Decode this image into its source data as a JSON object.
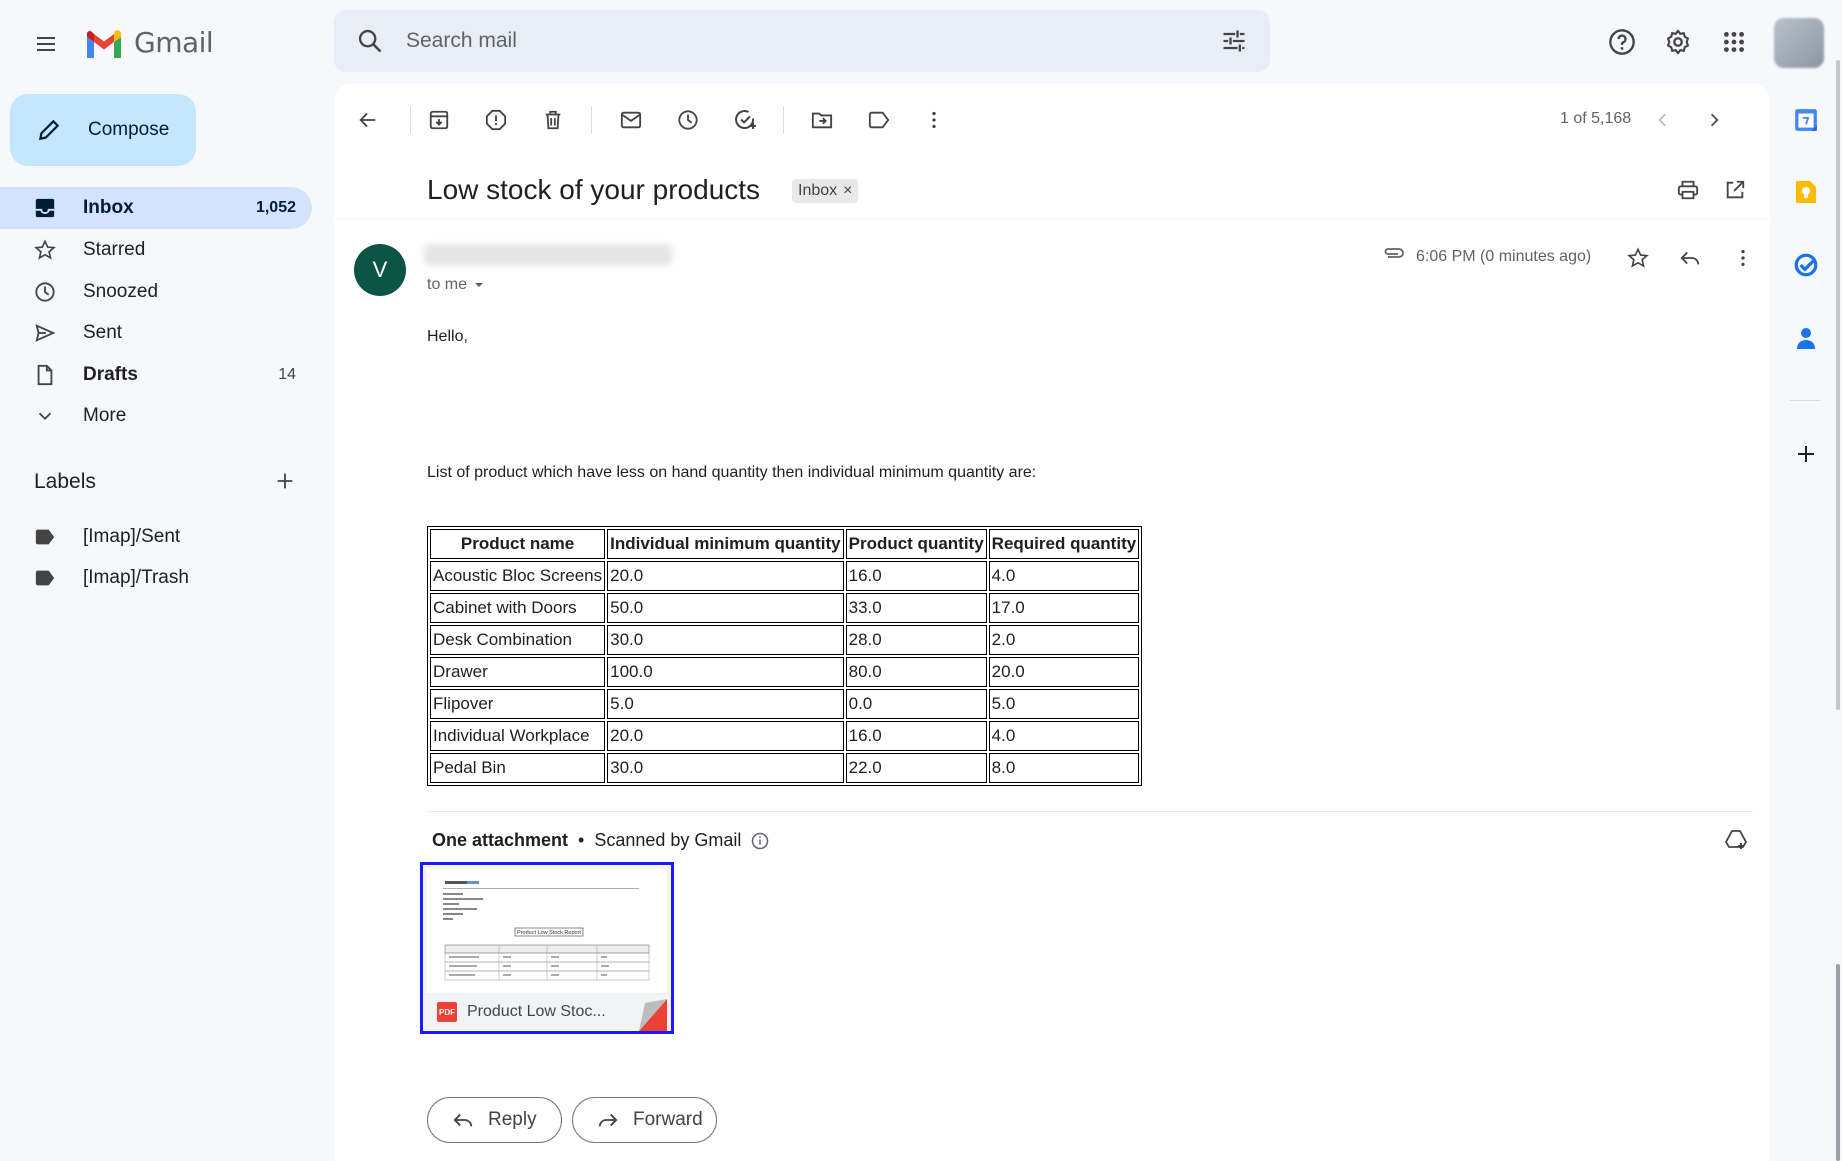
{
  "app": {
    "name": "Gmail"
  },
  "search": {
    "placeholder": "Search mail"
  },
  "compose": {
    "label": "Compose"
  },
  "nav": [
    {
      "label": "Inbox",
      "count": "1,052",
      "icon": "inbox-icon"
    },
    {
      "label": "Starred",
      "count": "",
      "icon": "star-icon"
    },
    {
      "label": "Snoozed",
      "count": "",
      "icon": "clock-icon"
    },
    {
      "label": "Sent",
      "count": "",
      "icon": "send-icon"
    },
    {
      "label": "Drafts",
      "count": "14",
      "icon": "draft-icon"
    },
    {
      "label": "More",
      "count": "",
      "icon": "chevron-down-icon"
    }
  ],
  "labels": {
    "header": "Labels",
    "items": [
      {
        "label": "[Imap]/Sent"
      },
      {
        "label": "[Imap]/Trash"
      }
    ]
  },
  "toolbar": {
    "pager": "1 of 5,168"
  },
  "message": {
    "subject": "Low stock of your products",
    "chip": "Inbox",
    "chip_close": "×",
    "avatar_letter": "V",
    "to": "to me",
    "time": "6:06 PM (0 minutes ago)",
    "greeting": "Hello,",
    "intro": "List of product which have less on hand quantity then individual minimum quantity are:"
  },
  "table": {
    "headers": [
      "Product name",
      "Individual minimum quantity",
      "Product quantity",
      "Required quantity"
    ],
    "rows": [
      [
        "Acoustic Bloc Screens",
        "20.0",
        "16.0",
        "4.0"
      ],
      [
        "Cabinet with Doors",
        "50.0",
        "33.0",
        "17.0"
      ],
      [
        "Desk Combination",
        "30.0",
        "28.0",
        "2.0"
      ],
      [
        "Drawer",
        "100.0",
        "80.0",
        "20.0"
      ],
      [
        "Flipover",
        "5.0",
        "0.0",
        "5.0"
      ],
      [
        "Individual Workplace",
        "20.0",
        "16.0",
        "4.0"
      ],
      [
        "Pedal Bin",
        "30.0",
        "22.0",
        "8.0"
      ]
    ]
  },
  "attachment": {
    "header": "One attachment",
    "dot": "•",
    "scanned": "Scanned by Gmail",
    "filename": "Product Low Stoc...",
    "type_badge": "PDF",
    "preview_title": "Product Low Stock Report"
  },
  "actions": {
    "reply": "Reply",
    "forward": "Forward"
  }
}
